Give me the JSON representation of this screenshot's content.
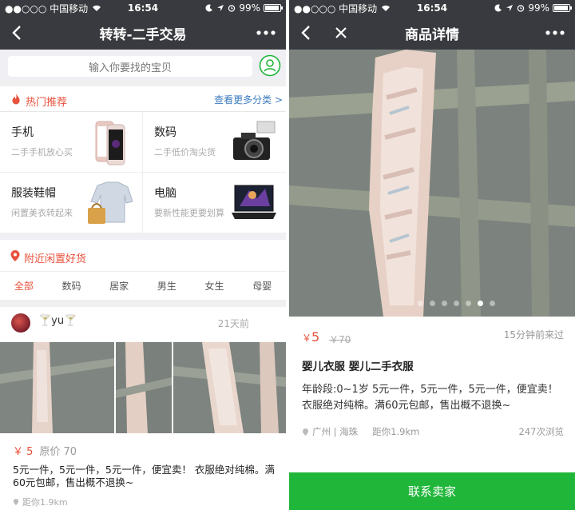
{
  "status_bar": {
    "carrier": "●●○○○ 中国移动",
    "time": "16:54",
    "battery": "99%"
  },
  "left": {
    "nav_title": "转转-二手交易",
    "search_placeholder": "输入你要找的宝贝",
    "hot": {
      "title": "热门推荐",
      "more": "查看更多分类 >"
    },
    "categories": [
      {
        "name": "手机",
        "sub": "二手手机放心买",
        "icon": "phone-image"
      },
      {
        "name": "数码",
        "sub": "二手低价淘尖货",
        "icon": "camera-image"
      },
      {
        "name": "服装鞋帽",
        "sub": "闲置美衣转起来",
        "icon": "clothing-image"
      },
      {
        "name": "电脑",
        "sub": "要新性能更要划算",
        "icon": "laptop-image"
      }
    ],
    "nearby": {
      "title": "附近闲置好货"
    },
    "tabs": [
      "全部",
      "数码",
      "居家",
      "男生",
      "女生",
      "母婴"
    ],
    "listing": {
      "user": "🍸yu🍸",
      "time_ago": "21天前",
      "price": "￥ 5",
      "orig_price": "原价 70",
      "description": "5元一件，5元一件，5元一件，便宜卖！ 衣服绝对纯棉。满60元包邮，售出概不退换~",
      "distance": "距你1.9km"
    }
  },
  "right": {
    "nav_title": "商品详情",
    "carousel": {
      "count": 7,
      "active_index": 5
    },
    "price_symbol": "￥",
    "price": "5",
    "orig_price": "￥70",
    "visited": "15分钟前来过",
    "title": "婴儿衣服 婴儿二手衣服",
    "description": "年龄段:0~1岁 5元一件，5元一件，5元一件，便宜卖！衣服绝对纯棉。满60元包邮，售出概不退换~",
    "location": "广州 | 海珠",
    "distance": "距你1.9km",
    "views": "247次浏览",
    "contact_label": "联系卖家"
  },
  "colors": {
    "navbar": "#393a3f",
    "accent_red": "#e8513b",
    "link_blue": "#3b7bbf",
    "contact_green": "#20b63a"
  }
}
